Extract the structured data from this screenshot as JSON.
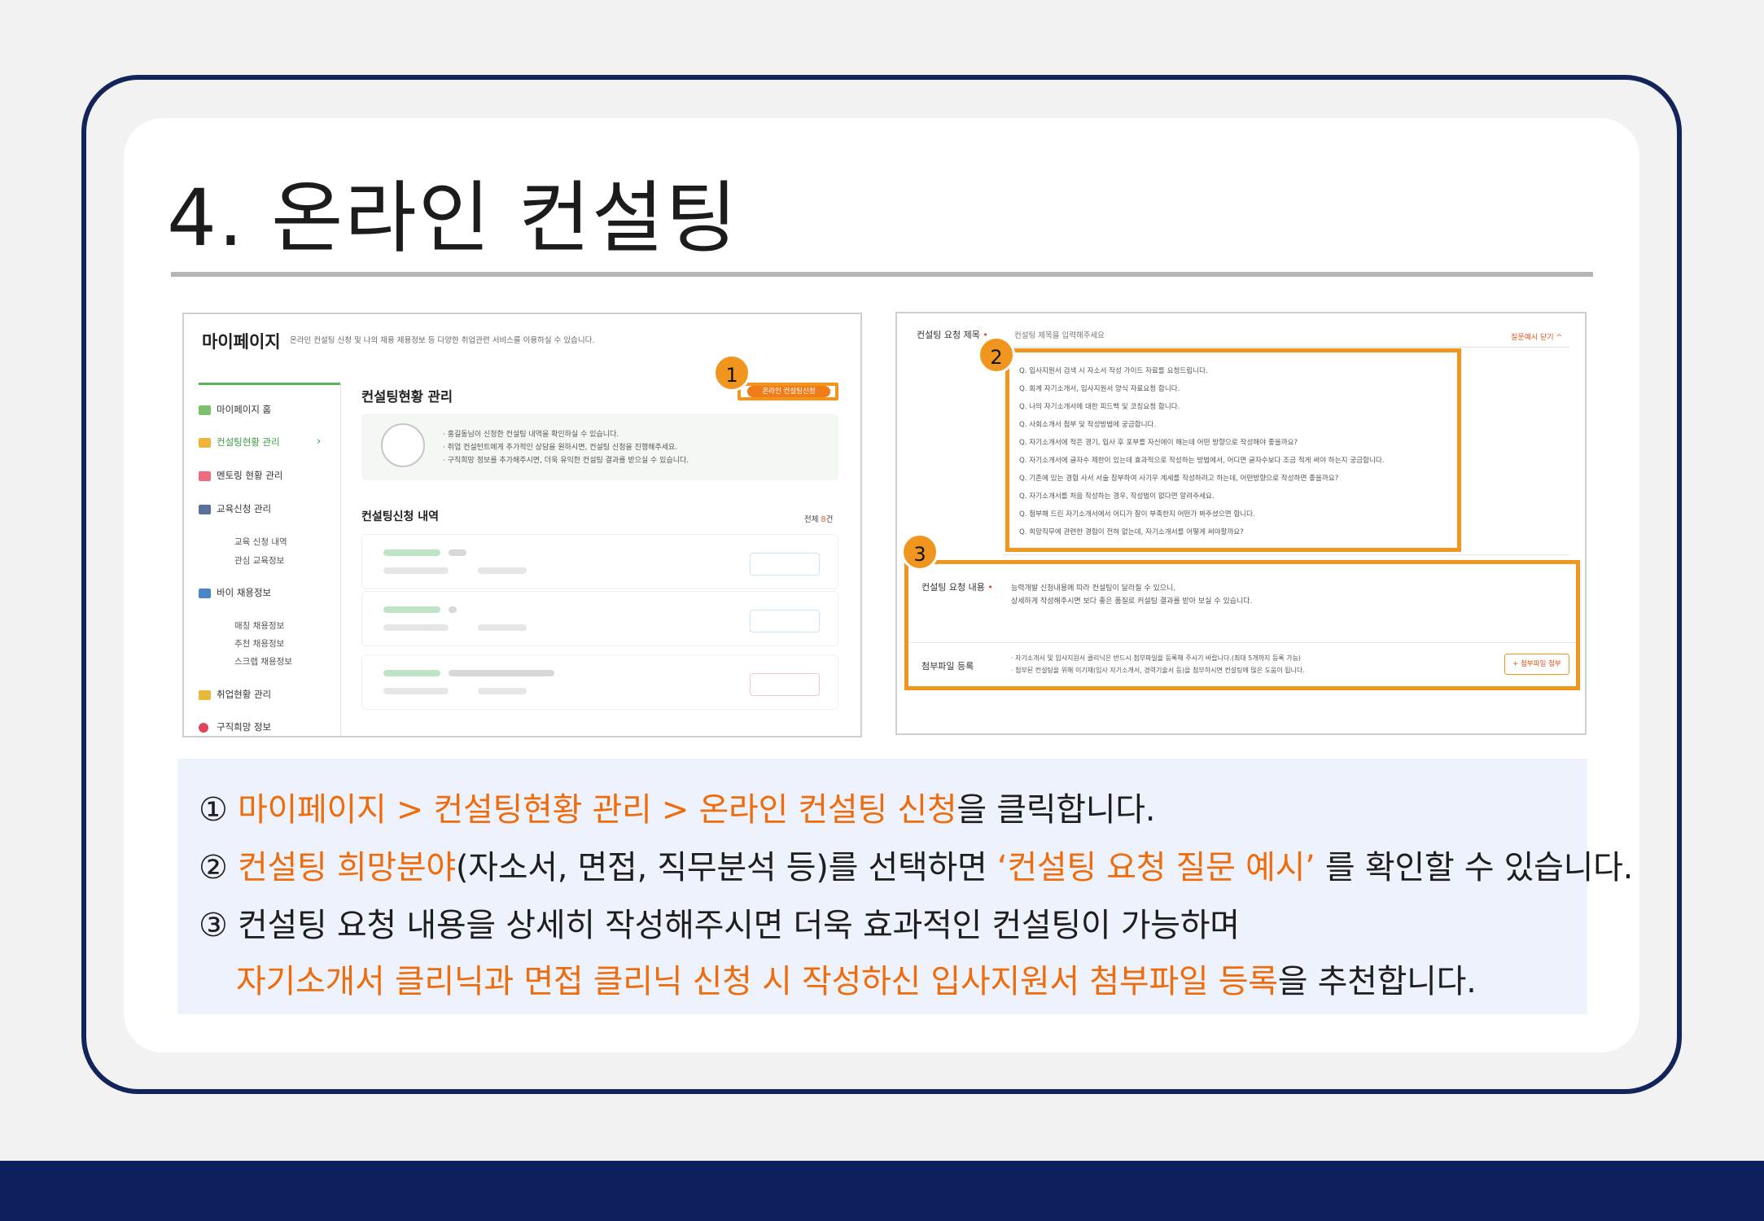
{
  "title": "4. 온라인 컨설팅",
  "left_shot": {
    "page_title": "마이페이지",
    "page_subtitle": "온라인 컨설팅 신청 및 나의 채용 제용정보 등 다양한 취업관련 서비스를 이용하실 수 있습니다.",
    "sidebar": {
      "items": [
        {
          "label": "마이페이지 홈"
        },
        {
          "label": "컨설팅현황 관리",
          "active": true
        },
        {
          "label": "멘토링 현황 관리"
        },
        {
          "label": "교육신청 관리"
        },
        {
          "label": "바이 채용정보"
        },
        {
          "label": "취업현황 관리"
        },
        {
          "label": "구직희망 정보"
        }
      ],
      "sub_education": [
        "교육 신청 내역",
        "관심 교육정보"
      ],
      "sub_jobs": [
        "매칭 채용정보",
        "추천 채용정보",
        "스크랩 채용정보"
      ]
    },
    "section_title": "컨설팅현황 관리",
    "apply_button": "온라인 컨설팅신청",
    "info_lines": [
      "· 홍길동님이 신청한 컨설팅 내역을 확인하실 수 있습니다.",
      "· 취업 컨설턴트에게 추가적인 상담을 원하시면, 컨설팅 신청을 진행해주세요.",
      "· 구직희망 정보를 추가해주시면, 더욱 유익한 컨설팅 결과를 받으실 수 있습니다."
    ],
    "list_title": "컨설팅신청 내역",
    "list_total_prefix": "전체",
    "list_total_count": "8",
    "list_total_suffix": "건"
  },
  "right_shot": {
    "request_title_label": "컨설팅 요청 제목",
    "request_title_placeholder": "컨설팅 제목을 입력해주세요",
    "examples_toggle": "질문예시 닫기 ^",
    "questions": [
      "Q. 입사지원서 검색 시 자소서 작성 가이드 자료를 요청드립니다.",
      "Q. 회계 자기소개서, 입사지원서 양식 자료요청 합니다.",
      "Q. 나의 자기소개서에 대한 피드백 및 코칭요청 합니다.",
      "Q. 사회소개서 첨부 및 작성방법에 궁금합니다.",
      "Q. 자기소개서에 적은 경기, 입사 후 포부를 자신에이 해는데 어떤 방향으로 작성해야 좋을까요?",
      "Q. 자기소개서에 글자수 제한이 있는데 효과적으로 작성하는 방법에서, 어디면 글자수보다 조금 적게 써야 하는지 궁금합니다.",
      "Q. 기존에 있는 경험 사서 서술 참부하여 사기우 계세를 작성하려고 하는데, 어떤방향으로 작성하면 좋을까요?",
      "Q. 자기소개서를 처음 작성하는 경우, 작성법이 없다면 알려주세요.",
      "Q. 첨부해 드린 자기소개서에서 어디가 잘이 부족한지 어떤가 봐주셨으면 합니다.",
      "Q. 희망직무에 관련한 경험이 전혀 없는데, 자기소개서를 어떻게 써야할까요?"
    ],
    "content_label": "컨설팅 요청 내용",
    "content_lines": [
      "능력개발 신청내용에 따라 컨설팅이 달라질 수 있으니,",
      "상세하게 작성해주시면 보다 좋은 품질로 커설팅 결과를 받아 보실 수 있습니다."
    ],
    "attach_label": "첨부파일 등록",
    "attach_lines": [
      "· 자기소개서 및 입사지원서 클리닉은 반드시 첨부파일을 등록해 주시기 바랍니다.(최대 5개까지 등록 가능)",
      "· 첨부된 컨설팅을 위해 이기재(입사 자기소개서, 경력기술서 등)을 첨부하시면 컨설팅에 많은 도움이 됩니다."
    ],
    "attach_button": "+ 첨부파일 첨부"
  },
  "badges": [
    "1",
    "2",
    "3"
  ],
  "instructions": [
    {
      "num": "①",
      "highlight": "마이페이지 > 컨설팅현황 관리 > 온라인 컨설팅 신청",
      "rest": "을 클릭합니다."
    },
    {
      "num": "②",
      "highlight": "컨설팅 희망분야",
      "mid": "(자소서, 면접, 직무분석 등)를 선택하면 ",
      "highlight2": "‘컨설팅 요청 질문 예시’",
      "rest": " 를 확인할 수 있습니다."
    },
    {
      "num": "③",
      "text": "컨설팅 요청 내용을 상세히 작성해주시면 더욱 효과적인 컨설팅이 가능하며",
      "highlight": "자기소개서 클리닉과 면접 클리닉 신청 시 작성하신 입사지원서 첨부파일 등록",
      "rest": "을 추천합니다."
    }
  ],
  "colors": {
    "navy": "#13245b",
    "orange": "#f0961e",
    "highlight_text": "#ef6c0c",
    "green": "#3c9c45"
  }
}
